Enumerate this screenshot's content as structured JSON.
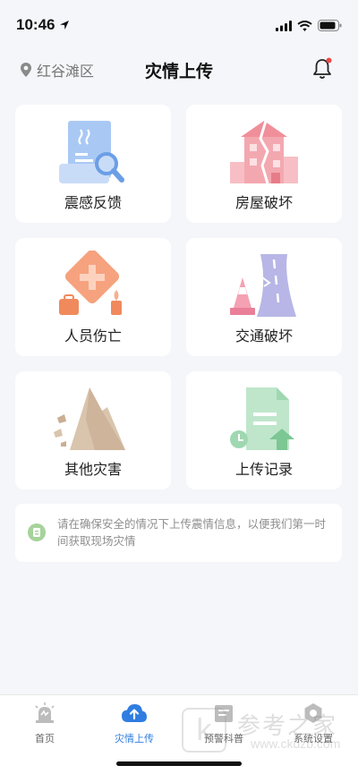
{
  "status_bar": {
    "time": "10:46"
  },
  "header": {
    "location": "红谷滩区",
    "title": "灾情上传"
  },
  "cards": [
    {
      "label": "震感反馈",
      "icon": "document-magnifier-icon"
    },
    {
      "label": "房屋破坏",
      "icon": "cracked-building-icon"
    },
    {
      "label": "人员伤亡",
      "icon": "medical-cross-icon"
    },
    {
      "label": "交通破坏",
      "icon": "damaged-road-icon"
    },
    {
      "label": "其他灾害",
      "icon": "landslide-icon"
    },
    {
      "label": "上传记录",
      "icon": "upload-record-icon"
    }
  ],
  "notice": {
    "text": "请在确保安全的情况下上传震情信息，以便我们第一时间获取现场灾情"
  },
  "tabs": [
    {
      "label": "首页",
      "icon": "alarm-light-icon",
      "active": false
    },
    {
      "label": "灾情上传",
      "icon": "cloud-upload-icon",
      "active": true
    },
    {
      "label": "预警科普",
      "icon": "warning-book-icon",
      "active": false
    },
    {
      "label": "系统设置",
      "icon": "settings-icon",
      "active": false
    }
  ],
  "watermark": {
    "brand": "参考之家",
    "url": "www.ckdzb.com",
    "letter": "k"
  },
  "colors": {
    "accent": "#2f7de1",
    "notice_icon": "#a6d39b",
    "bell_dot": "#f04848"
  }
}
